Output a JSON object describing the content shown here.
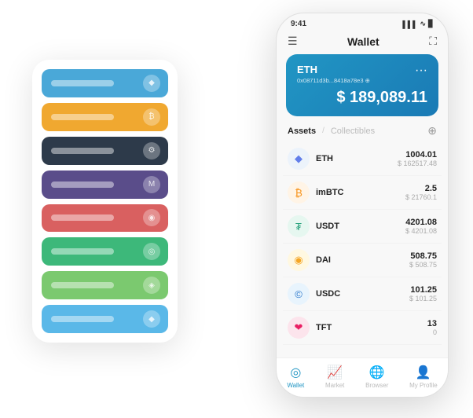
{
  "statusBar": {
    "time": "9:41",
    "signal": "▌▌▌",
    "wifi": "WiFi",
    "battery": "🔋"
  },
  "header": {
    "menuIcon": "☰",
    "title": "Wallet",
    "expandIcon": "⛶"
  },
  "ethCard": {
    "ticker": "ETH",
    "address": "0x08711d3b...8418a78e3",
    "addressSuffix": "⊕",
    "dots": "···",
    "balancePrefix": "$",
    "balance": "189,089.11"
  },
  "assetsTabs": {
    "activeTab": "Assets",
    "divider": "/",
    "inactiveTab": "Collectibles",
    "addIcon": "⊕"
  },
  "assets": [
    {
      "name": "ETH",
      "iconSymbol": "◆",
      "iconClass": "icon-eth",
      "amount": "1004.01",
      "usd": "$ 162517.48"
    },
    {
      "name": "imBTC",
      "iconSymbol": "₿",
      "iconClass": "icon-imbtc",
      "amount": "2.5",
      "usd": "$ 21760.1"
    },
    {
      "name": "USDT",
      "iconSymbol": "₮",
      "iconClass": "icon-usdt",
      "amount": "4201.08",
      "usd": "$ 4201.08"
    },
    {
      "name": "DAI",
      "iconSymbol": "◉",
      "iconClass": "icon-dai",
      "amount": "508.75",
      "usd": "$ 508.75"
    },
    {
      "name": "USDC",
      "iconSymbol": "©",
      "iconClass": "icon-usdc",
      "amount": "101.25",
      "usd": "$ 101.25"
    },
    {
      "name": "TFT",
      "iconSymbol": "❤",
      "iconClass": "icon-tft",
      "amount": "13",
      "usd": "0"
    }
  ],
  "bottomNav": [
    {
      "icon": "◎",
      "label": "Wallet",
      "active": true
    },
    {
      "icon": "📈",
      "label": "Market",
      "active": false
    },
    {
      "icon": "🌐",
      "label": "Browser",
      "active": false
    },
    {
      "icon": "👤",
      "label": "My Profile",
      "active": false
    }
  ],
  "backPanel": {
    "cards": [
      {
        "colorClass": "row-blue",
        "label": "",
        "iconText": "◆"
      },
      {
        "colorClass": "row-orange",
        "label": "",
        "iconText": "₿"
      },
      {
        "colorClass": "row-dark",
        "label": "",
        "iconText": "⚙"
      },
      {
        "colorClass": "row-purple",
        "label": "",
        "iconText": "M"
      },
      {
        "colorClass": "row-red",
        "label": "",
        "iconText": "◉"
      },
      {
        "colorClass": "row-green",
        "label": "",
        "iconText": "◎"
      },
      {
        "colorClass": "row-lightgreen",
        "label": "",
        "iconText": "◈"
      },
      {
        "colorClass": "row-sky",
        "label": "",
        "iconText": "◆"
      }
    ]
  }
}
